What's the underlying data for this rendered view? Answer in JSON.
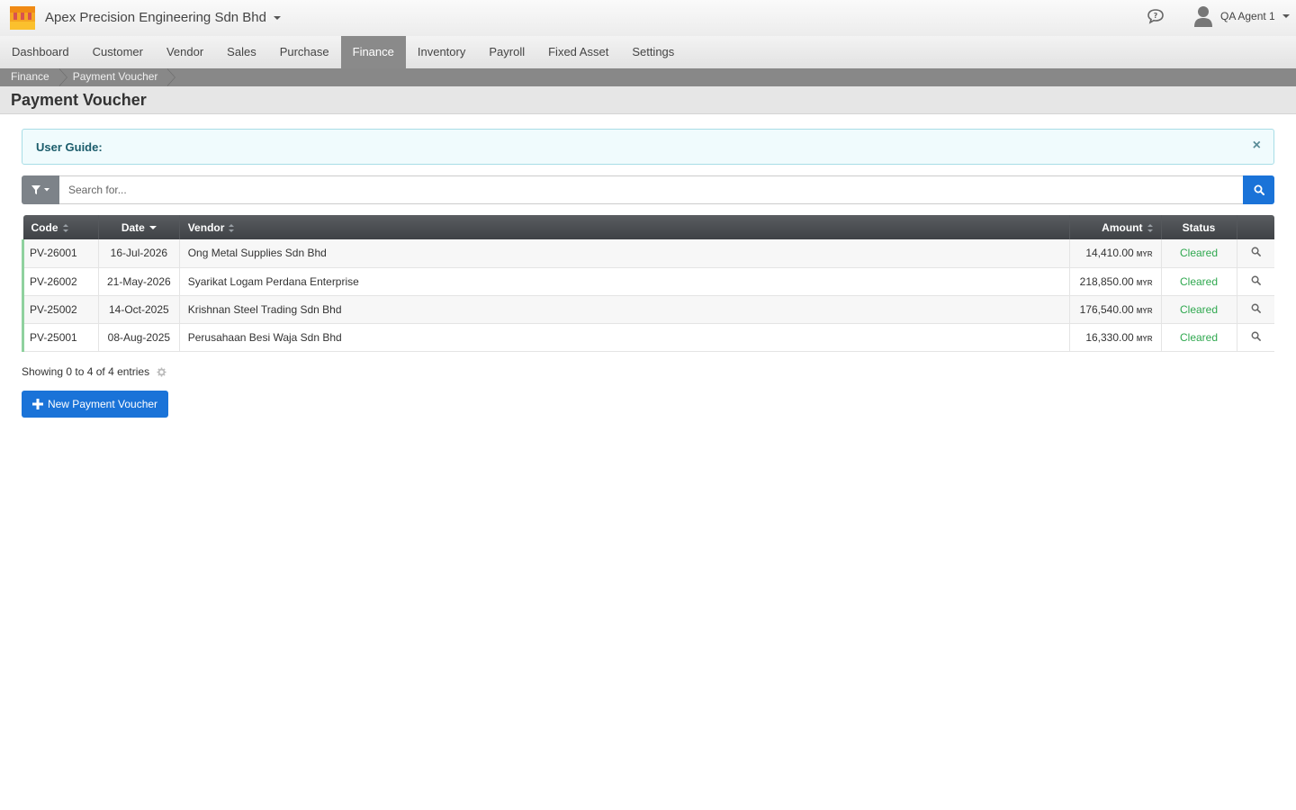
{
  "app": {
    "company_name": "Apex Precision Engineering Sdn Bhd",
    "user_name": "QA Agent 1"
  },
  "nav": {
    "items": [
      {
        "label": "Dashboard"
      },
      {
        "label": "Customer"
      },
      {
        "label": "Vendor"
      },
      {
        "label": "Sales"
      },
      {
        "label": "Purchase"
      },
      {
        "label": "Finance",
        "active": true
      },
      {
        "label": "Inventory"
      },
      {
        "label": "Payroll"
      },
      {
        "label": "Fixed Asset"
      },
      {
        "label": "Settings"
      }
    ]
  },
  "breadcrumb": [
    "Finance",
    "Payment Voucher"
  ],
  "page": {
    "title": "Payment Voucher"
  },
  "guide": {
    "title": "User Guide:",
    "close": "×"
  },
  "search": {
    "placeholder": "Search for..."
  },
  "table": {
    "columns": {
      "code": "Code",
      "date": "Date",
      "vendor": "Vendor",
      "amount": "Amount",
      "status": "Status"
    },
    "rows": [
      {
        "code": "PV-26001",
        "date": "16-Jul-2026",
        "vendor": "Ong Metal Supplies Sdn Bhd",
        "amount": "14,410.00",
        "currency": "MYR",
        "status": "Cleared"
      },
      {
        "code": "PV-26002",
        "date": "21-May-2026",
        "vendor": "Syarikat Logam Perdana Enterprise",
        "amount": "218,850.00",
        "currency": "MYR",
        "status": "Cleared"
      },
      {
        "code": "PV-25002",
        "date": "14-Oct-2025",
        "vendor": "Krishnan Steel Trading Sdn Bhd",
        "amount": "176,540.00",
        "currency": "MYR",
        "status": "Cleared"
      },
      {
        "code": "PV-25001",
        "date": "08-Aug-2025",
        "vendor": "Perusahaan Besi Waja Sdn Bhd",
        "amount": "16,330.00",
        "currency": "MYR",
        "status": "Cleared"
      }
    ]
  },
  "footer": {
    "showing": "Showing 0 to 4 of 4 entries"
  },
  "actions": {
    "new_button": "New Payment Voucher"
  },
  "colors": {
    "accent": "#1a73d8",
    "status_cleared": "#2fa84f",
    "active_nav": "#8a8a8a"
  },
  "icons": [
    "logo-icon",
    "chevron-down-icon",
    "chat-icon",
    "user-icon",
    "filter-icon",
    "search-icon",
    "sort-icon",
    "magnifier-icon",
    "cog-icon",
    "plus-icon",
    "close-icon"
  ]
}
